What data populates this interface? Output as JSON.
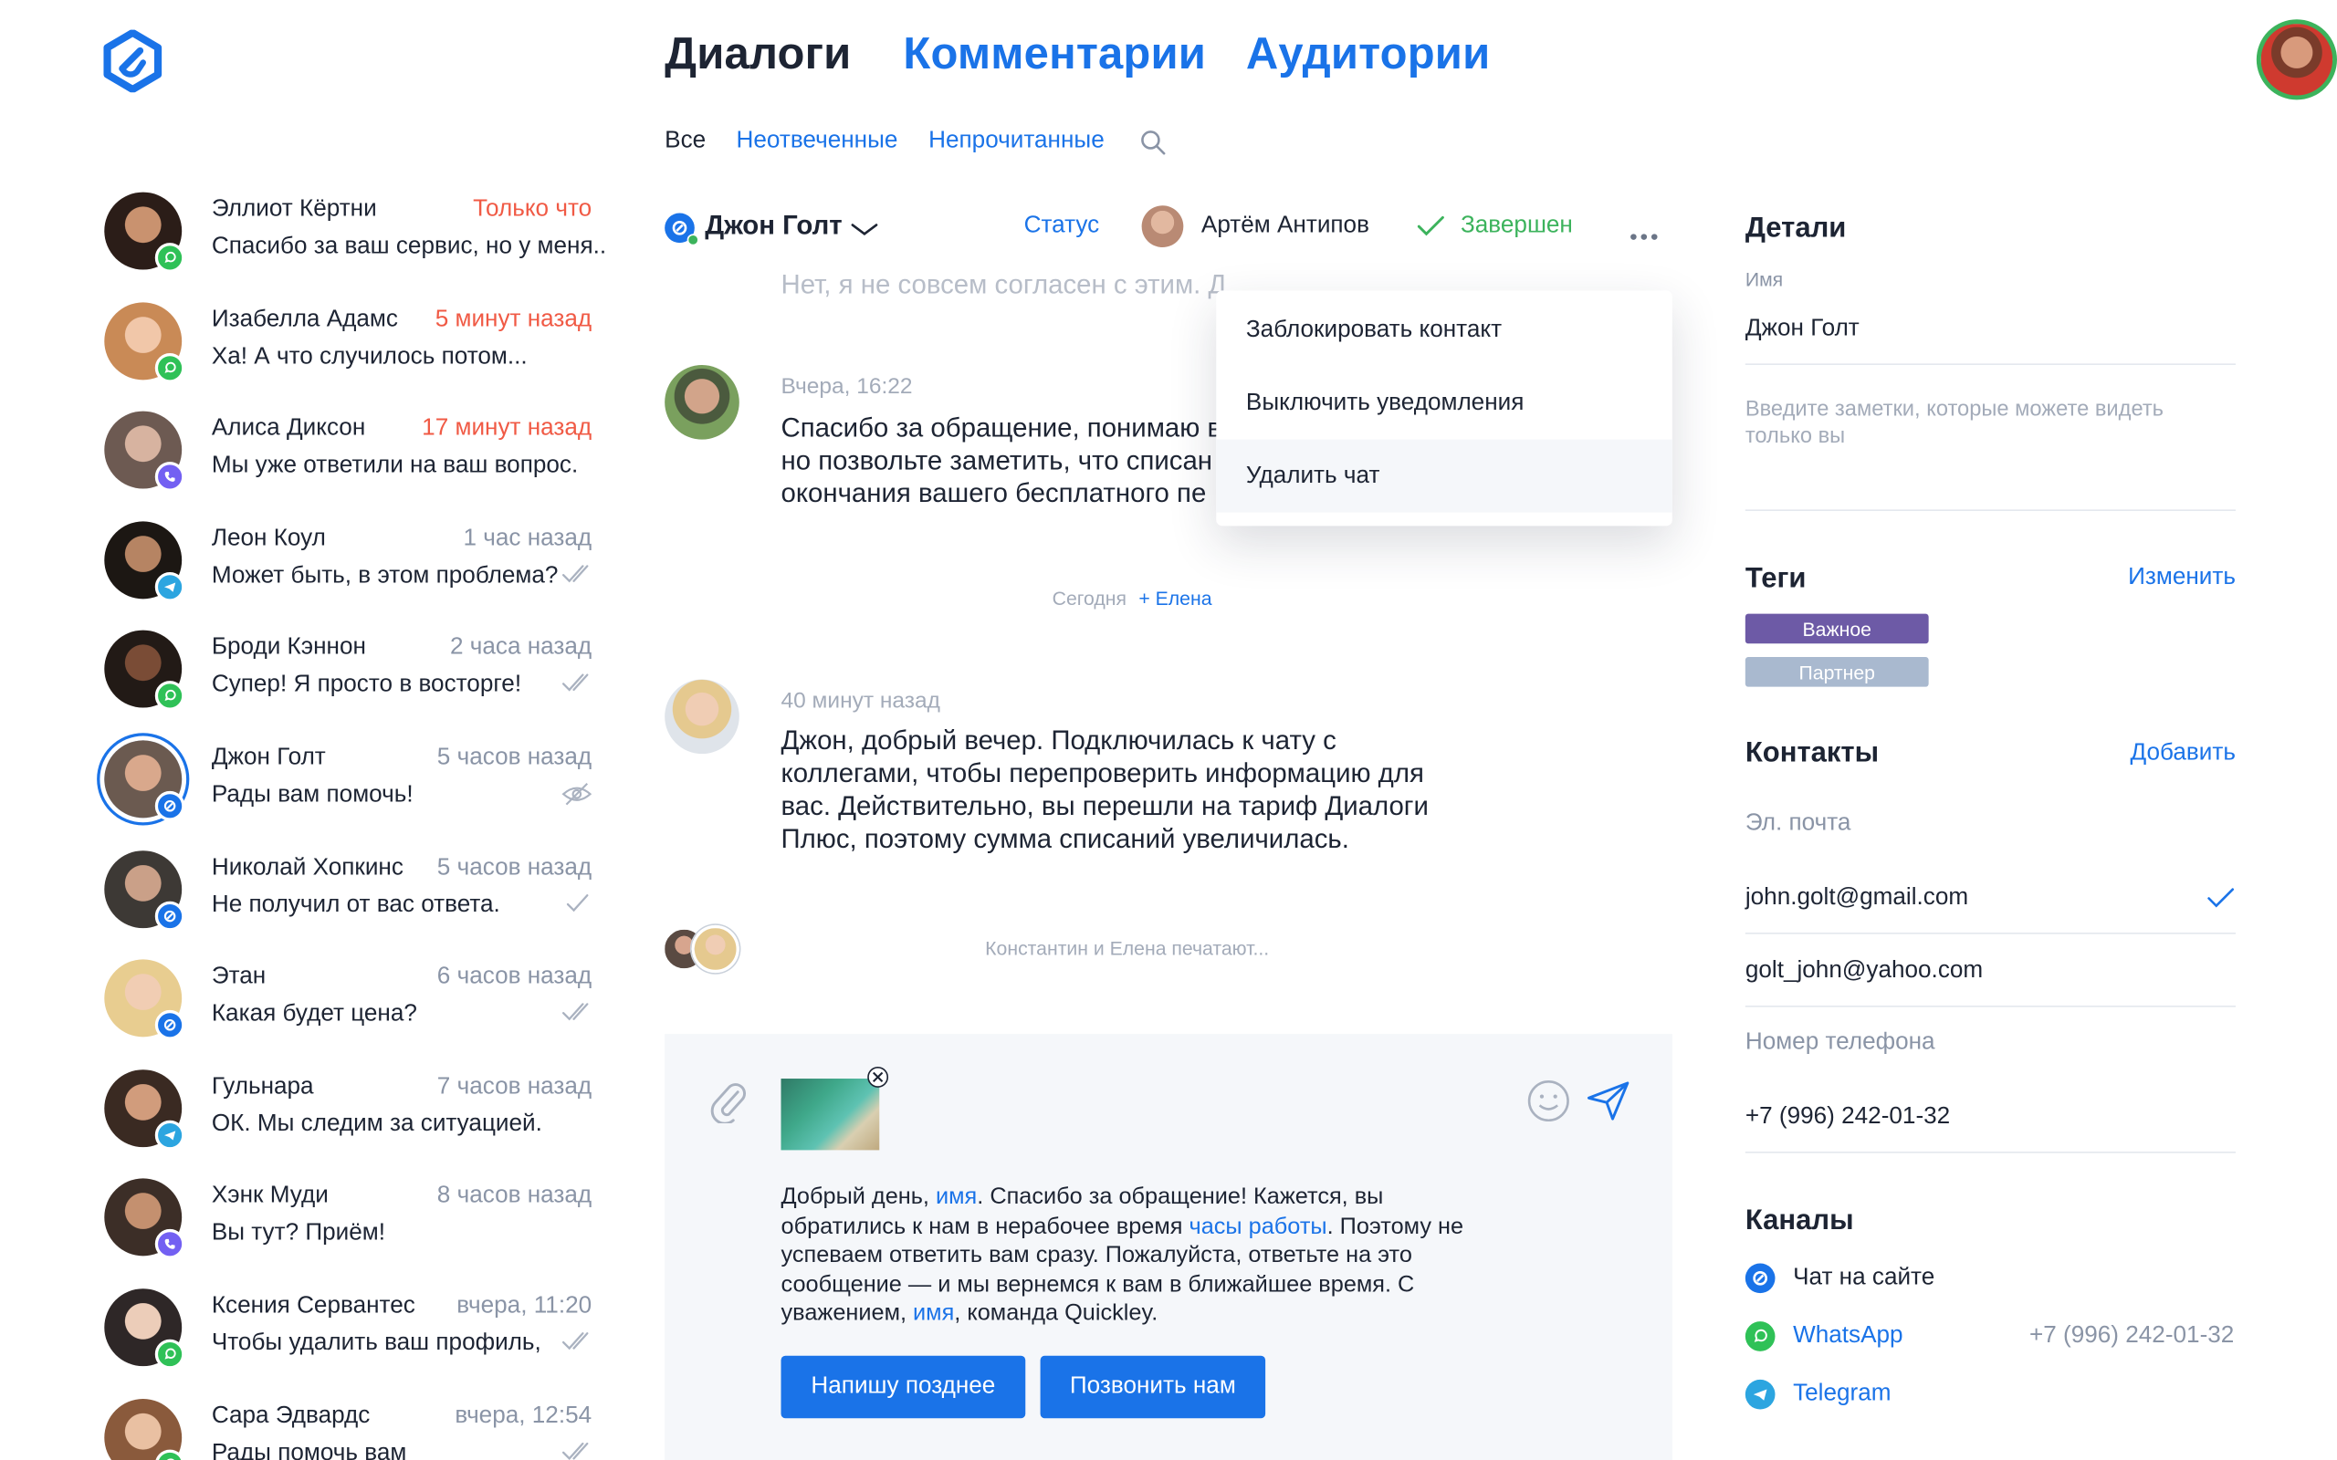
{
  "nav": {
    "tabs": [
      "Диалоги",
      "Комментарии",
      "Аудитории"
    ],
    "filters": [
      "Все",
      "Неотвеченные",
      "Непрочитанные"
    ]
  },
  "colors": {
    "accent": "#1a73e8",
    "unread_time": "#f05a45",
    "completed": "#3cb35c",
    "tag_important": "#6d5aa6",
    "tag_partner": "#a9b9cf",
    "whatsapp": "#2fc157",
    "telegram": "#2ca5e0",
    "viber": "#7360f2"
  },
  "conversations": [
    {
      "name": "Эллиот Кёртни",
      "time": "Только что",
      "preview": "Спасибо за ваш сервис, но у меня..",
      "channel": "whatsapp-icon",
      "status": "unread"
    },
    {
      "name": "Изабелла Адамс",
      "time": "5 минут назад",
      "preview": "Ха! А что случилось потом...",
      "channel": "whatsapp-icon",
      "status": "unread"
    },
    {
      "name": "Алиса Диксон",
      "time": "17 минут назад",
      "preview": "Мы уже ответили на ваш вопрос.",
      "channel": "viber-icon",
      "status": "unread"
    },
    {
      "name": "Леон Коул",
      "time": "1 час назад",
      "preview": "Может быть, в этом проблема?",
      "channel": "telegram-icon",
      "status": "read"
    },
    {
      "name": "Броди Кэннон",
      "time": "2 часа назад",
      "preview": "Супер! Я просто в восторге!",
      "channel": "whatsapp-icon",
      "status": "read"
    },
    {
      "name": "Джон Голт",
      "time": "5 часов назад",
      "preview": "Рады вам помочь!",
      "channel": "site-chat-icon",
      "status": "hidden"
    },
    {
      "name": "Николай Хопкинс",
      "time": "5 часов назад",
      "preview": "Не получил от вас ответа.",
      "channel": "site-chat-icon",
      "status": "sent"
    },
    {
      "name": "Этан",
      "time": "6 часов назад",
      "preview": "Какая будет цена?",
      "channel": "site-chat-icon",
      "status": "read"
    },
    {
      "name": "Гульнара",
      "time": "7 часов назад",
      "preview": "ОК. Мы следим за ситуацией.",
      "channel": "telegram-icon",
      "status": "none"
    },
    {
      "name": "Хэнк Муди",
      "time": "8 часов назад",
      "preview": "Вы тут? Приём!",
      "channel": "viber-icon",
      "status": "none"
    },
    {
      "name": "Ксения Сервантес",
      "time": "вчера, 11:20",
      "preview": "Чтобы удалить ваш профиль,",
      "channel": "whatsapp-icon",
      "status": "read"
    },
    {
      "name": "Сара Эдвардс",
      "time": "вчера, 12:54",
      "preview": "Рады помочь вам",
      "channel": "whatsapp-icon",
      "status": "read"
    }
  ],
  "chat": {
    "contact": "Джон Голт",
    "status_label": "Статус",
    "assignee": "Артём Антипов",
    "state": "Завершен",
    "faded_message": "Нет, я не совсем согласен с этим. Д",
    "msg1": {
      "meta": "Вчера, 16:22",
      "lines": [
        "Спасибо за обращение, понимаю в",
        "но позвольте заметить, что списан",
        "окончания вашего бесплатного пе"
      ]
    },
    "separator": {
      "day": "Сегодня",
      "added": "+ Елена"
    },
    "msg2": {
      "meta": "40 минут назад",
      "lines": [
        "Джон, добрый вечер. Подключилась к чату с",
        "коллегами, чтобы перепроверить информацию для",
        "вас. Действительно, вы перешли на тариф Диалоги",
        "Плюс, поэтому сумма списаний увеличилась."
      ]
    },
    "typing": "Константин и Елена печатают..."
  },
  "menu": [
    "Заблокировать контакт",
    "Выключить уведомления",
    "Удалить чат"
  ],
  "composer": {
    "p1": "Добрый день, ",
    "v1": "имя",
    "p2": ". Спасибо за обращение! Кажется, вы обратились к нам в нерабочее время ",
    "v2": "часы работы",
    "p3": ". Поэтому не успеваем ответить вам сразу. Пожалуйста, ответьте на это сообщение — и мы вернемся к вам в ближайшее время. С уважением, ",
    "v3": "имя",
    "p4": ", команда Quickley.",
    "buttons": [
      "Напишу позднее",
      "Позвонить нам"
    ]
  },
  "details": {
    "title": "Детали",
    "name_label": "Имя",
    "name": "Джон Голт",
    "notes_placeholder": "Введите заметки, которые можете видеть только вы",
    "tags_title": "Теги",
    "tags_action": "Изменить",
    "tags": [
      "Важное",
      "Партнер"
    ],
    "contacts_title": "Контакты",
    "contacts_action": "Добавить",
    "email_label": "Эл. почта",
    "emails": [
      "john.golt@gmail.com",
      "golt_john@yahoo.com"
    ],
    "phone_label": "Номер телефона",
    "phone": "+7 (996) 242-01-32",
    "channels_title": "Каналы",
    "channels": [
      {
        "name": "Чат на сайте",
        "icon": "site-chat-icon"
      },
      {
        "name": "WhatsApp",
        "icon": "whatsapp-icon",
        "value": "+7 (996) 242-01-32"
      },
      {
        "name": "Telegram",
        "icon": "telegram-icon"
      }
    ]
  }
}
